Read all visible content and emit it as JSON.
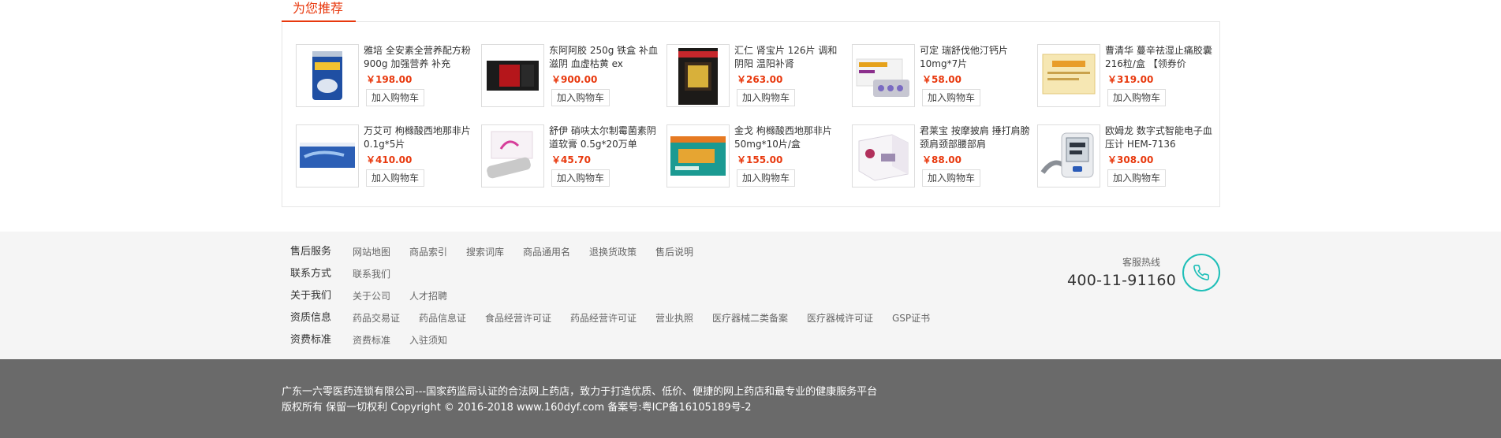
{
  "recommend": {
    "tab_title": "为您推荐",
    "cart_label": "加入购物车",
    "products": [
      {
        "name": "雅培 全安素全营养配方粉 900g 加强营养 补充",
        "price": "￥198.00",
        "image": "milk-powder-can"
      },
      {
        "name": "东阿阿胶 250g 铁盒 补血滋阴 血虚枯黄 ex",
        "price": "￥900.00",
        "image": "red-black-gift-box"
      },
      {
        "name": "汇仁 肾宝片 126片 调和阴阳 温阳补肾",
        "price": "￥263.00",
        "image": "dark-box"
      },
      {
        "name": "可定 瑞舒伐他汀钙片 10mg*7片",
        "price": "￥58.00",
        "image": "white-box-blister"
      },
      {
        "name": "曹清华 蔓辛祛湿止痛胶囊216粒/盒 【领券价",
        "price": "￥319.00",
        "image": "yellow-box"
      },
      {
        "name": "万艾可 枸橼酸西地那非片 0.1g*5片",
        "price": "￥410.00",
        "image": "blue-box"
      },
      {
        "name": "舒伊 硝呋太尔制霉菌素阴道软膏 0.5g*20万单",
        "price": "￥45.70",
        "image": "white-pink-box"
      },
      {
        "name": "金戈 枸橼酸西地那非片 50mg*10片/盒",
        "price": "￥155.00",
        "image": "teal-orange-box"
      },
      {
        "name": "君莱宝 按摩披肩 捶打肩膀颈肩颈部腰部肩",
        "price": "￥88.00",
        "image": "massager-box"
      },
      {
        "name": "欧姆龙 数字式智能电子血压计 HEM-7136",
        "price": "￥308.00",
        "image": "blood-pressure-monitor"
      }
    ]
  },
  "footer": {
    "rows": [
      {
        "title": "售后服务",
        "links": [
          "网站地图",
          "商品索引",
          "搜索词库",
          "商品通用名",
          "退换货政策",
          "售后说明"
        ]
      },
      {
        "title": "联系方式",
        "links": [
          "联系我们"
        ]
      },
      {
        "title": "关于我们",
        "links": [
          "关于公司",
          "人才招聘"
        ]
      },
      {
        "title": "资质信息",
        "links": [
          "药品交易证",
          "药品信息证",
          "食品经营许可证",
          "药品经营许可证",
          "营业执照",
          "医疗器械二类备案",
          "医疗器械许可证",
          "GSP证书"
        ]
      },
      {
        "title": "资费标准",
        "links": [
          "资费标准",
          "入驻须知"
        ]
      }
    ],
    "hotline_label": "客服热线",
    "hotline_number": "400-11-91160",
    "icon": "phone-icon"
  },
  "copyright": {
    "line1": "广东一六零医药连锁有限公司---国家药监局认证的合法网上药店，致力于打造优质、低价、便捷的网上药店和最专业的健康服务平台",
    "line2": "版权所有 保留一切权利 Copyright © 2016-2018 www.160dyf.com 备案号:粤ICP备16105189号-2"
  },
  "colors": {
    "accent": "#e8380d",
    "phone_icon": "#1fbfb8",
    "footer_bg": "#f5f5f5",
    "copyright_bg": "#6a6a6a"
  }
}
